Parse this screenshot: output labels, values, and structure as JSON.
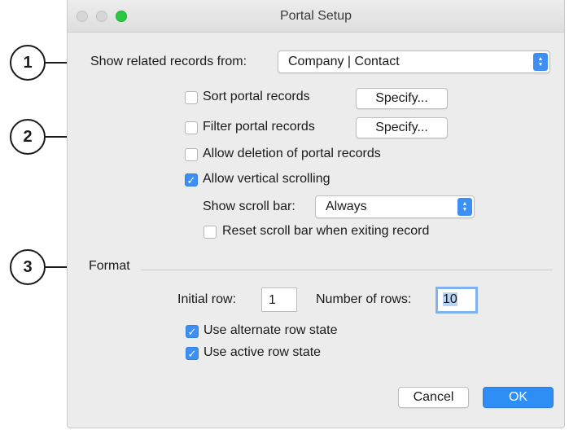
{
  "window": {
    "title": "Portal Setup"
  },
  "callouts": [
    "1",
    "2",
    "3"
  ],
  "related": {
    "label": "Show related records from:",
    "value": "Company | Contact"
  },
  "options": {
    "sort": {
      "label": "Sort portal records",
      "checked": false,
      "button": "Specify..."
    },
    "filter": {
      "label": "Filter portal records",
      "checked": false,
      "button": "Specify..."
    },
    "allow_deletion": {
      "label": "Allow deletion of portal records",
      "checked": false
    },
    "vertical_scrolling": {
      "label": "Allow vertical scrolling",
      "checked": true
    },
    "scroll_bar": {
      "label": "Show scroll bar:",
      "value": "Always"
    },
    "reset_scroll": {
      "label": "Reset scroll bar when exiting record",
      "checked": false
    }
  },
  "format": {
    "heading": "Format",
    "initial_row": {
      "label": "Initial row:",
      "value": "1"
    },
    "num_rows": {
      "label": "Number of rows:",
      "value": "10"
    },
    "alternate_row": {
      "label": "Use alternate row state",
      "checked": true
    },
    "active_row": {
      "label": "Use active row state",
      "checked": true
    }
  },
  "buttons": {
    "cancel": "Cancel",
    "ok": "OK"
  },
  "colors": {
    "accent": "#3e8ff3",
    "close": "#d6d6d6",
    "minimize": "#d6d6d6",
    "zoom": "#29c940"
  },
  "glyphs": {
    "check": "✓",
    "stepper_up": "▲",
    "stepper_down": "▼"
  }
}
